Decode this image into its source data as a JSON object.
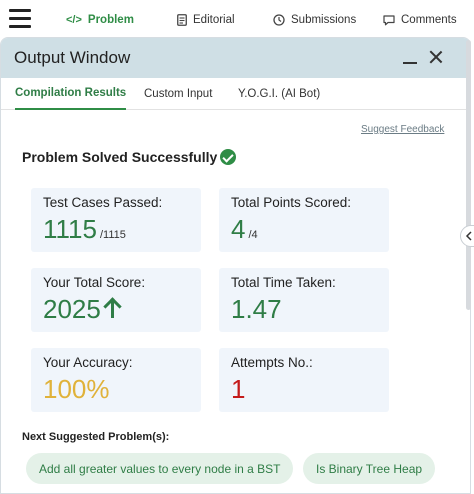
{
  "top_tabs": [
    {
      "label": "Problem",
      "icon": "code-icon",
      "active": true
    },
    {
      "label": "Editorial",
      "icon": "document-icon",
      "active": false
    },
    {
      "label": "Submissions",
      "icon": "clock-icon",
      "active": false
    },
    {
      "label": "Comments",
      "icon": "comment-icon",
      "active": false
    }
  ],
  "output_window": {
    "title": "Output Window",
    "tabs": [
      {
        "label": "Compilation Results",
        "active": true
      },
      {
        "label": "Custom Input",
        "active": false
      },
      {
        "label": "Y.O.G.I. (AI Bot)",
        "active": false
      }
    ],
    "suggest_feedback": "Suggest Feedback",
    "status": "Problem Solved Successfully"
  },
  "stats": {
    "test_cases": {
      "label": "Test Cases Passed:",
      "value": "1115",
      "total": "/1115"
    },
    "points": {
      "label": "Total Points Scored:",
      "value": "4",
      "total": "/4"
    },
    "score": {
      "label": "Your Total Score:",
      "value": "2025"
    },
    "time": {
      "label": "Total Time Taken:",
      "value": "1.47"
    },
    "accuracy": {
      "label": "Your Accuracy:",
      "value": "100%"
    },
    "attempts": {
      "label": "Attempts No.:",
      "value": "1"
    }
  },
  "next": {
    "label": "Next Suggested Problem(s):",
    "problems": [
      "Add all greater values to every node in a BST",
      "Is Binary Tree Heap"
    ]
  },
  "colors": {
    "accent_green": "#2f8d46",
    "header_bg": "#cfdfe5",
    "card_bg": "#f0f5fb",
    "accuracy_gold": "#e0b23a",
    "attempts_red": "#c41b1b",
    "chip_bg": "#e4f1e8"
  }
}
